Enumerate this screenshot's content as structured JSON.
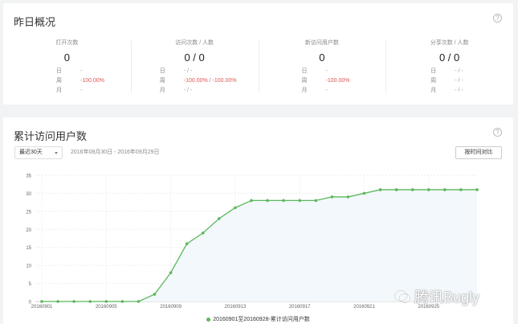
{
  "overview": {
    "title": "昨日概况",
    "help": "?",
    "stats": [
      {
        "label": "打开次数",
        "value": "0",
        "rows": [
          {
            "k": "日",
            "v": "-"
          },
          {
            "k": "周",
            "v": "-100.00%"
          },
          {
            "k": "月",
            "v": "-"
          }
        ]
      },
      {
        "label": "访问次数 / 人数",
        "value": "0 / 0",
        "rows": [
          {
            "k": "日",
            "v": "- / -"
          },
          {
            "k": "周",
            "v": "-100.00% / -100.00%"
          },
          {
            "k": "月",
            "v": "- / -"
          }
        ]
      },
      {
        "label": "新访问用户数",
        "value": "0",
        "rows": [
          {
            "k": "日",
            "v": "-"
          },
          {
            "k": "周",
            "v": "-100.00%"
          },
          {
            "k": "月",
            "v": "-"
          }
        ]
      },
      {
        "label": "分享次数 / 人数",
        "value": "0 / 0",
        "rows": [
          {
            "k": "日",
            "v": "- / -"
          },
          {
            "k": "周",
            "v": "- / -"
          },
          {
            "k": "月",
            "v": "- / -"
          }
        ]
      }
    ]
  },
  "trend": {
    "title": "累计访问用户数",
    "help": "?",
    "range_select": "最近30天",
    "date_range": "2016年08月30日 - 2016年09月29日",
    "compare_button": "按时间对比"
  },
  "colors": {
    "line": "#5cb85c",
    "area": "#f2f8fb",
    "negative": "#e05555"
  },
  "chart_data": {
    "type": "line",
    "x": [
      "20160901",
      "20160902",
      "20160903",
      "20160904",
      "20160905",
      "20160906",
      "20160907",
      "20160908",
      "20160909",
      "20160910",
      "20160911",
      "20160912",
      "20160913",
      "20160914",
      "20160915",
      "20160916",
      "20160917",
      "20160918",
      "20160919",
      "20160920",
      "20160921",
      "20160922",
      "20160923",
      "20160924",
      "20160925",
      "20160926",
      "20160927",
      "20160928"
    ],
    "tick_labels": [
      "20160901",
      "20160905",
      "20160909",
      "20160913",
      "20160917",
      "20160921",
      "20160925"
    ],
    "series": [
      {
        "name": "20160901至20160928-累计访问用户数",
        "values": [
          0,
          0,
          0,
          0,
          0,
          0,
          0,
          2,
          8,
          16,
          19,
          23,
          26,
          28,
          28,
          28,
          28,
          28,
          29,
          29,
          30,
          31,
          31,
          31,
          31,
          31,
          31,
          31
        ]
      }
    ],
    "yticks": [
      0,
      5,
      10,
      15,
      20,
      25,
      30,
      35
    ],
    "ylim": [
      0,
      35
    ],
    "grid": true,
    "legend_position": "bottom-center"
  },
  "watermark": {
    "text": "腾讯Bugly"
  }
}
